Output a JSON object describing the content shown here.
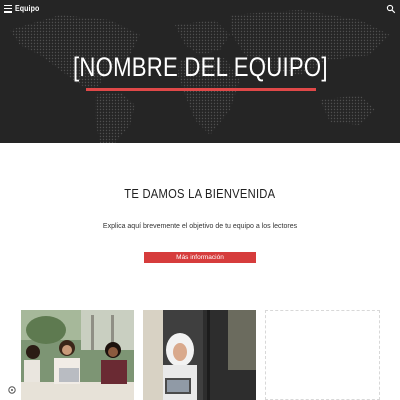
{
  "header": {
    "site_title": "Equipo",
    "menu_icon": "hamburger-menu-icon",
    "search_icon": "search-icon"
  },
  "hero": {
    "title": "[NOMBRE DEL EQUIPO]",
    "accent_color": "#e04848",
    "background_color": "#2c2c2c"
  },
  "welcome": {
    "heading": "TE DAMOS LA BIENVENIDA",
    "intro_text": "Explica aquí brevemente el objetivo de tu equipo a los lectores",
    "button_label": "Más información",
    "button_color": "#d63c3c"
  },
  "gallery": {
    "cards": [
      {
        "type": "photo"
      },
      {
        "type": "photo"
      },
      {
        "type": "empty"
      }
    ]
  },
  "footer": {
    "info_icon": "gear-icon"
  }
}
